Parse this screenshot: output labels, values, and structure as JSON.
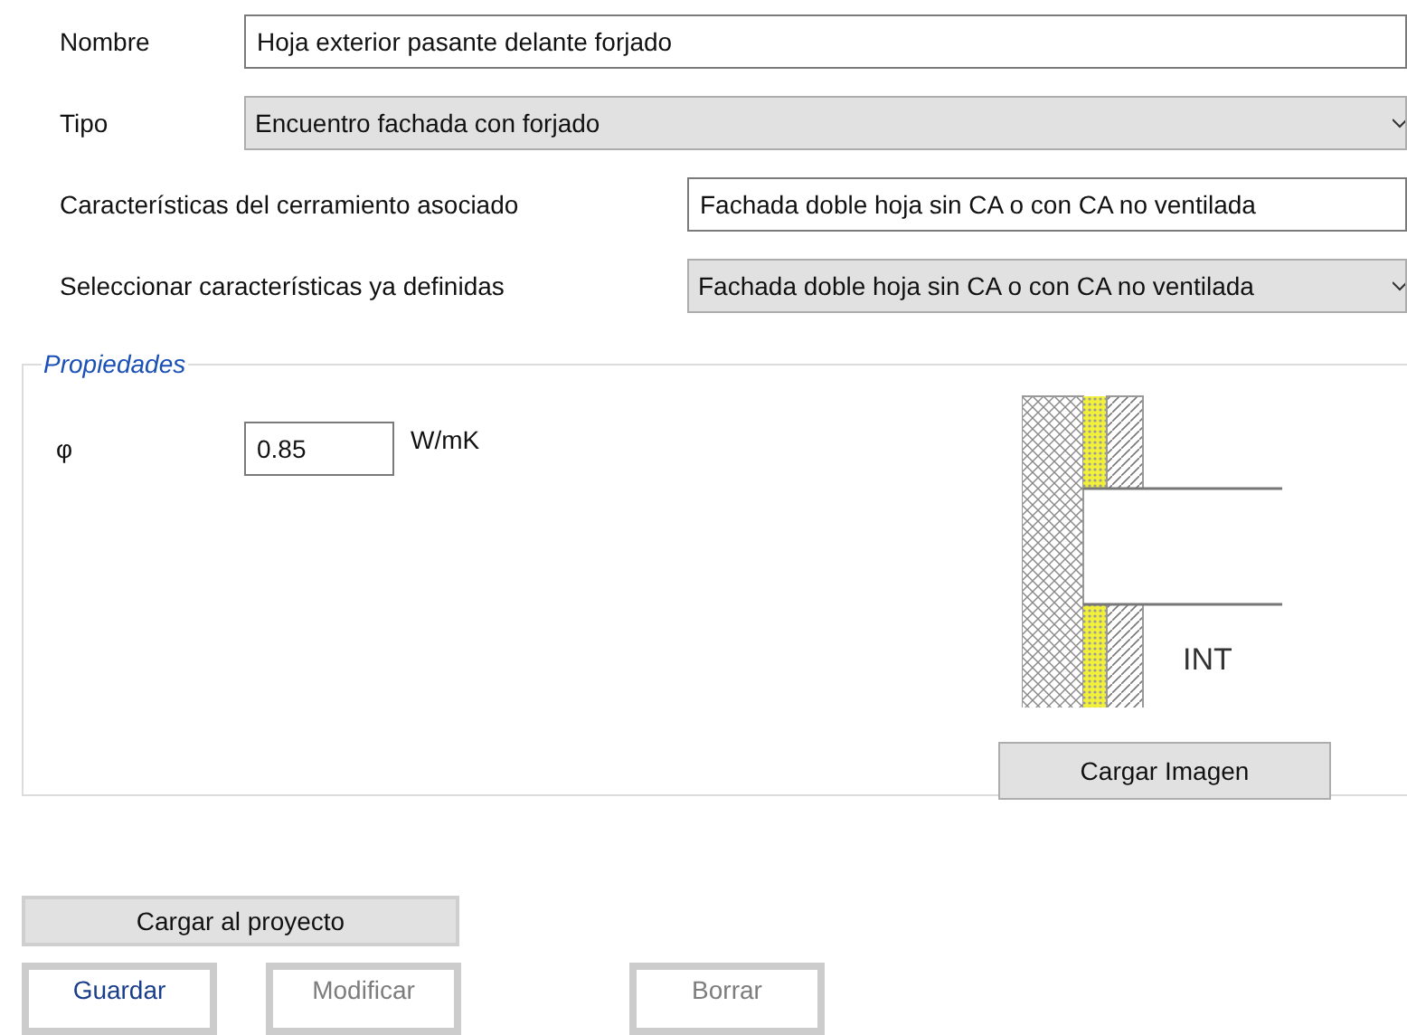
{
  "fields": [
    {
      "kind": "text",
      "label": "Nombre",
      "value": "Hoja exterior pasante delante forjado"
    },
    {
      "kind": "select",
      "label": "Tipo",
      "value": "Encuentro fachada con forjado"
    },
    {
      "kind": "text",
      "label": "Características del cerramiento asociado",
      "value": "Fachada doble hoja sin CA o con CA no ventilada"
    },
    {
      "kind": "select",
      "label": "Seleccionar características ya definidas",
      "value": "Fachada doble hoja sin CA o con CA no ventilada"
    }
  ],
  "properties": {
    "title": "Propiedades",
    "symbol": "φ",
    "value": "0.85",
    "unit": "W/mK",
    "diagram_label": "INT",
    "load_image_button": "Cargar Imagen"
  },
  "load_button": "Cargar al proyecto",
  "actions": [
    {
      "label": "Guardar",
      "disabled": false
    },
    {
      "label": "Modificar",
      "disabled": true
    },
    {
      "label": "Borrar",
      "disabled": true
    }
  ]
}
